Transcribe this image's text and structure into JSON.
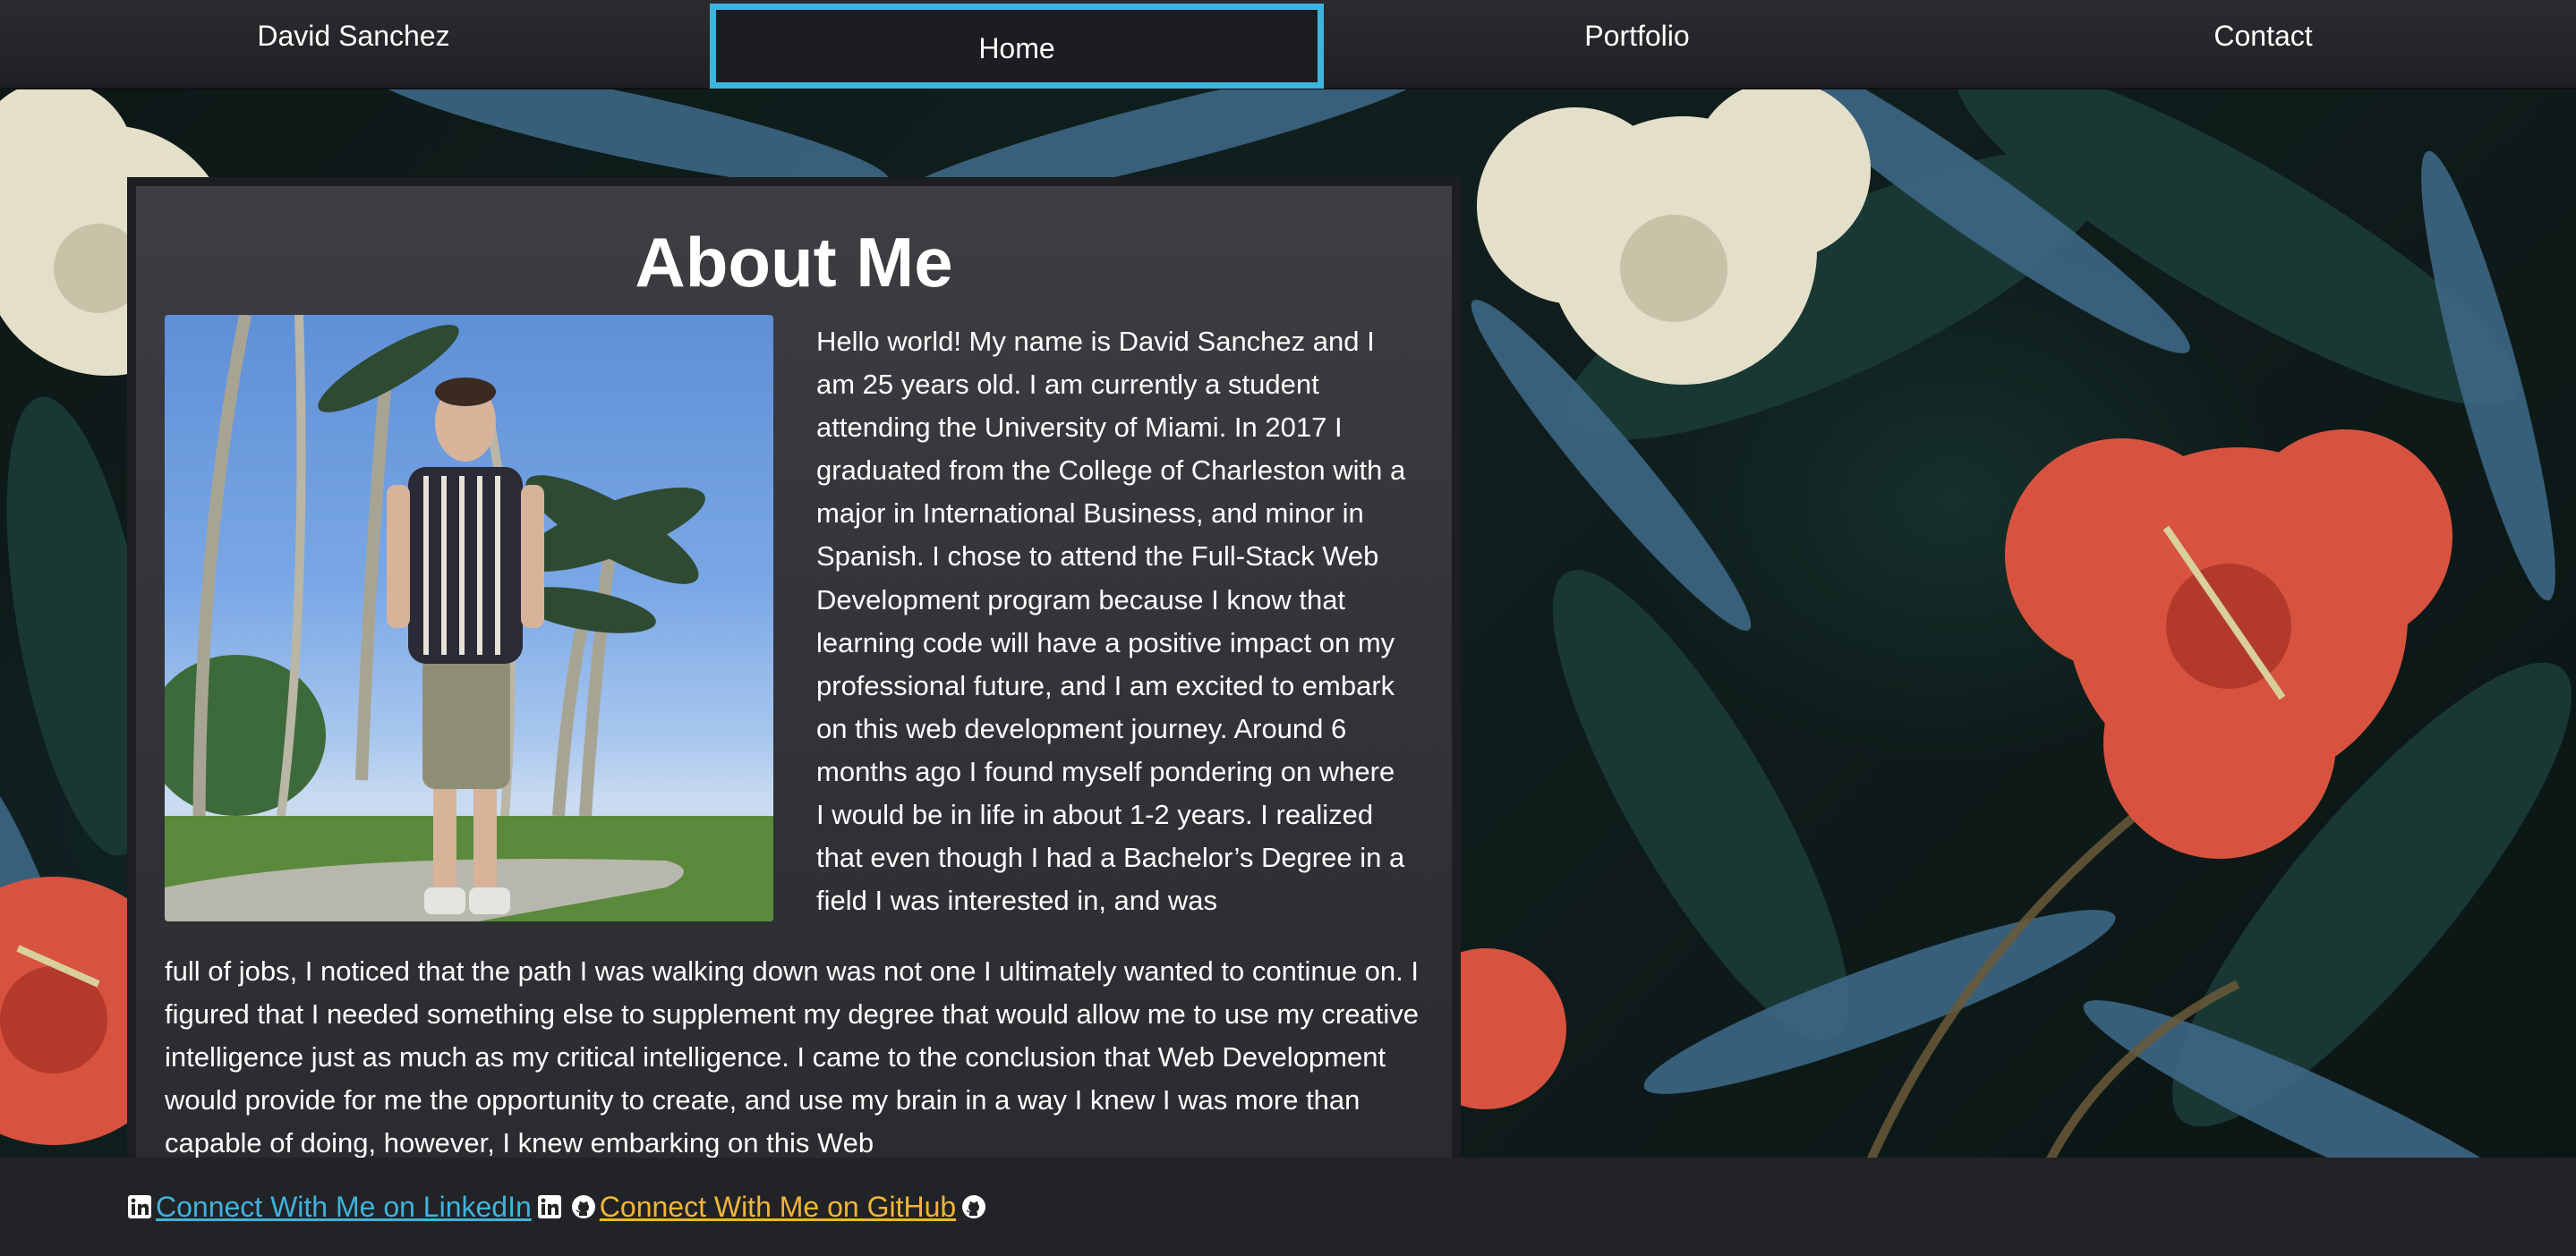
{
  "navbar": {
    "brand": "David Sanchez",
    "items": [
      "Home",
      "Portfolio",
      "Contact"
    ],
    "active_item": "Home"
  },
  "about": {
    "title": "About Me",
    "photo_alt": "David Sanchez standing among palm trees",
    "bio_right": "Hello world! My name is David Sanchez and I am 25 years old. I am currently a student attending the University of Miami. In 2017 I graduated from the College of Charleston with a major in International Business, and minor in Spanish. I chose to attend the Full-Stack Web Development program because I know that learning code will have a positive impact on my professional future, and I am excited to embark on this web development journey. Around 6 months ago I found myself pondering on where I would be in life in about 1-2 years. I realized that even though I had a Bachelor’s Degree in a field I was interested in, and was",
    "bio_bottom": "full of jobs, I noticed that the path I was walking down was not one I ultimately wanted to continue on. I figured that I needed something else to supplement my degree that would allow me to use my creative intelligence just as much as my critical intelligence. I came to the conclusion that Web Development would provide for me the opportunity to create, and use my brain in a way I knew I was more than capable of doing, however, I knew embarking on this Web"
  },
  "footer": {
    "linkedin_label": " Connect With Me on LinkedIn ",
    "github_label": " Connect With Me on GitHub "
  },
  "colors": {
    "active_border": "#3cb6e0",
    "linkedin_link": "#3fb3de",
    "github_link": "#f2b534",
    "navbar_bg": "#252629",
    "footer_bg": "#222326"
  },
  "icons": {
    "linkedin": "linkedin-icon",
    "github": "github-icon"
  }
}
